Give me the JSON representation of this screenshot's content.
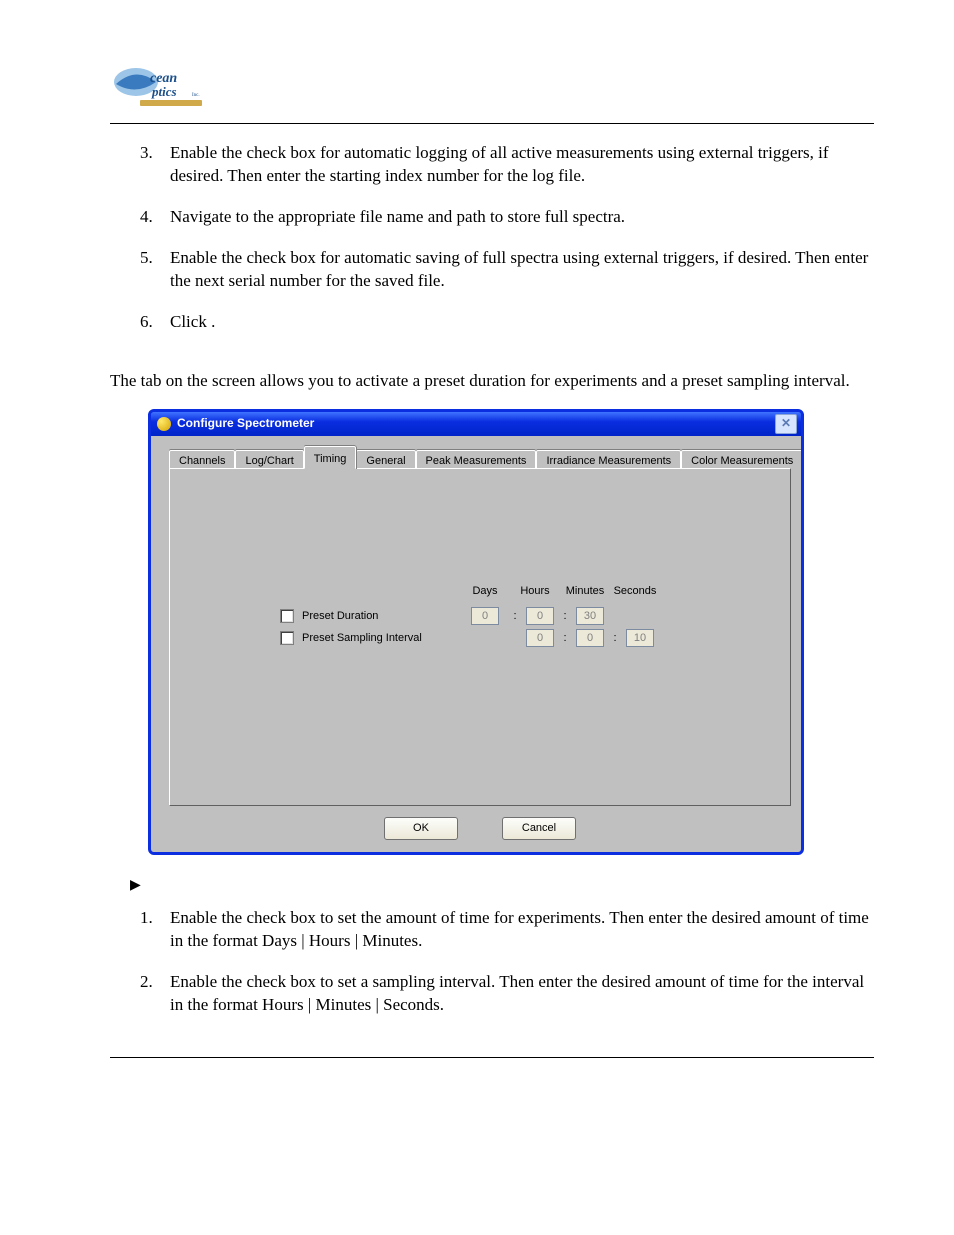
{
  "steps_top": [
    {
      "n": "3.",
      "text": "Enable the                                                                              check box for automatic logging of all active measurements using external triggers, if desired. Then enter the starting index number for the log file."
    },
    {
      "n": "4.",
      "text": "Navigate to the appropriate file name and path to store full spectra."
    },
    {
      "n": "5.",
      "text": "Enable the                                                          check box for automatic saving of full spectra using external triggers, if desired. Then enter the next serial number for the saved file."
    },
    {
      "n": "6.",
      "text": "Click       ."
    }
  ],
  "section_para": "The                  tab on the                                            screen allows you to activate a preset duration for experiments and a preset sampling interval.",
  "steps_bottom": [
    {
      "n": "1.",
      "text": "Enable the                                  check box to set the amount of time for experiments. Then enter the desired amount of time in the format Days | Hours | Minutes."
    },
    {
      "n": "2.",
      "text": "Enable the                                                   check box to set a sampling interval. Then enter the desired amount of time for the interval in the format Hours | Minutes | Seconds."
    }
  ],
  "dialog": {
    "title": "Configure Spectrometer",
    "tabs": [
      "Channels",
      "Log/Chart",
      "Timing",
      "General",
      "Peak Measurements",
      "Irradiance Measurements",
      "Color Measurements"
    ],
    "active_tab": 2,
    "headers": [
      "Days",
      "Hours",
      "Minutes",
      "Seconds"
    ],
    "row1": {
      "label": "Preset Duration",
      "vals": [
        "0",
        "0",
        "30",
        ""
      ]
    },
    "row2": {
      "label": "Preset Sampling Interval",
      "vals": [
        "",
        "0",
        "0",
        "10"
      ]
    },
    "ok": "OK",
    "cancel": "Cancel"
  }
}
